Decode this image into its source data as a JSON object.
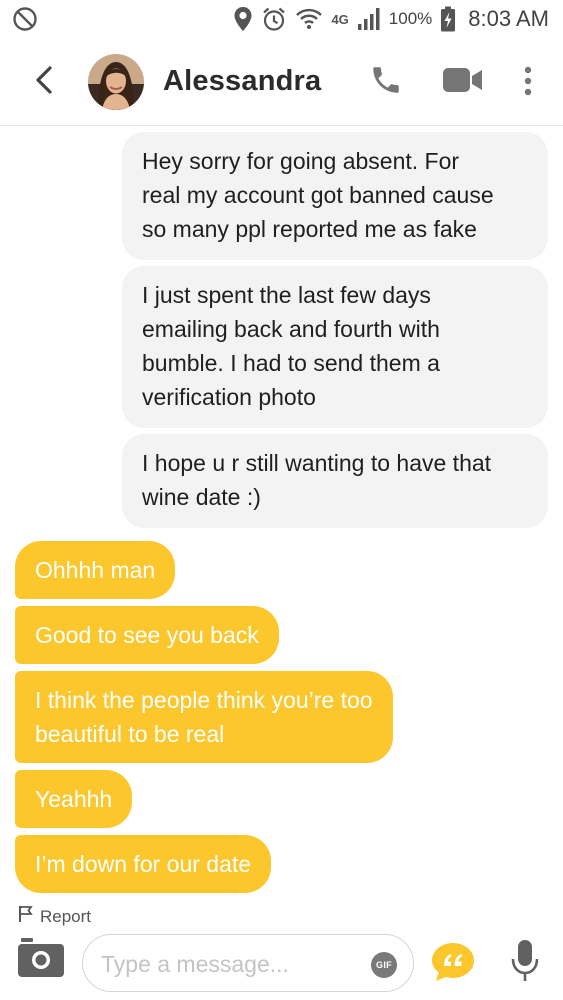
{
  "status_bar": {
    "network_label": "4G",
    "battery": "100%",
    "time": "8:03 AM"
  },
  "header": {
    "contact_name": "Alessandra"
  },
  "messages": [
    {
      "direction": "incoming",
      "text": "Hey sorry for going absent. For\nreal my account got banned cause\nso many ppl reported me as fake"
    },
    {
      "direction": "incoming",
      "text": "I just spent the last few days\nemailing back and fourth with\nbumble. I had to send them a\nverification photo"
    },
    {
      "direction": "incoming",
      "text": "I hope u r still wanting to have that\nwine date :)"
    },
    {
      "direction": "outgoing",
      "text": "Ohhhh man"
    },
    {
      "direction": "outgoing",
      "text": "Good to see you back"
    },
    {
      "direction": "outgoing",
      "text": "I think the people think you’re too\nbeautiful to be real"
    },
    {
      "direction": "outgoing",
      "text": "Yeahhh"
    },
    {
      "direction": "outgoing",
      "text": "I’m down for our date"
    }
  ],
  "report": {
    "label": "Report"
  },
  "composer": {
    "placeholder": "Type a message...",
    "gif_label": "GIF"
  },
  "colors": {
    "accent": "#fcc62d",
    "incoming_bubble": "#f3f3f3",
    "icon_gray": "#757575"
  },
  "icons": {
    "status": [
      "do-not-disturb-icon",
      "location-icon",
      "alarm-icon",
      "wifi-icon",
      "signal-icon",
      "battery-charging-icon"
    ],
    "header": [
      "back-arrow-icon",
      "phone-icon",
      "video-camera-icon",
      "more-vertical-icon"
    ],
    "composer": [
      "camera-icon",
      "gif-icon",
      "quick-reply-icon",
      "microphone-icon"
    ]
  }
}
